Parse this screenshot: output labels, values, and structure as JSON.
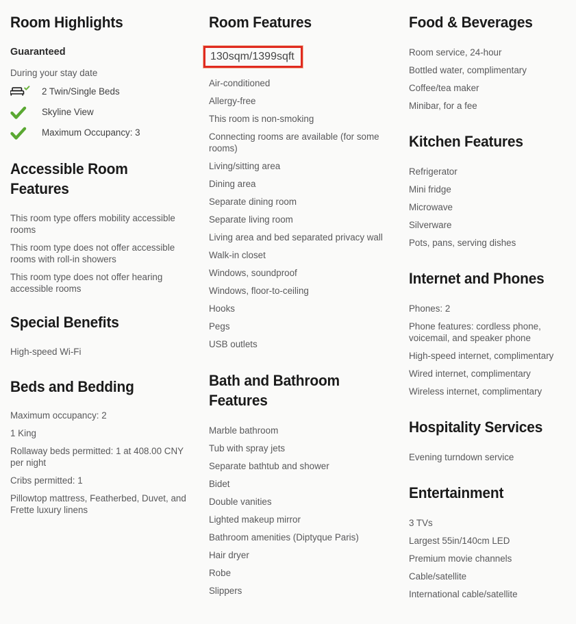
{
  "page": {
    "background": "#fafaf9",
    "text_color": "#58585a",
    "heading_color": "#1a1a1a",
    "accent_green": "#5aa832",
    "highlight_red": "#e02b20"
  },
  "columns": {
    "left": {
      "room_highlights": {
        "title": "Room Highlights",
        "subhead": "Guaranteed",
        "subnote": "During your stay date",
        "rows": [
          {
            "icon": "bed-check-icon",
            "label": "2 Twin/Single Beds"
          },
          {
            "icon": "check-icon",
            "label": "Skyline View"
          },
          {
            "icon": "check-icon",
            "label": "Maximum Occupancy: 3"
          }
        ]
      },
      "accessible_room_features": {
        "title": "Accessible Room Features",
        "items": [
          "This room type offers mobility accessible rooms",
          "This room type does not offer accessible rooms with roll-in showers",
          "This room type does not offer hearing accessible rooms"
        ]
      },
      "special_benefits": {
        "title": "Special Benefits",
        "items": [
          "High-speed Wi-Fi"
        ]
      },
      "beds_and_bedding": {
        "title": "Beds and Bedding",
        "items": [
          "Maximum occupancy: 2",
          "1 King",
          "Rollaway beds permitted: 1 at 408.00 CNY per night",
          "Cribs permitted: 1",
          "Pillowtop mattress, Featherbed, Duvet, and Frette luxury linens"
        ]
      }
    },
    "middle": {
      "room_features": {
        "title": "Room Features",
        "highlighted_item": "130sqm/1399sqft",
        "items": [
          "Air-conditioned",
          "Allergy-free",
          "This room is non-smoking",
          "Connecting rooms are available (for some rooms)",
          "Living/sitting area",
          "Dining area",
          "Separate dining room",
          "Separate living room",
          "Living area and bed separated privacy wall",
          "Walk-in closet",
          "Windows, soundproof",
          "Windows, floor-to-ceiling",
          "Hooks",
          "Pegs",
          "USB outlets"
        ]
      },
      "bath_and_bathroom_features": {
        "title": "Bath and Bathroom Features",
        "items": [
          "Marble bathroom",
          "Tub with spray jets",
          "Separate bathtub and shower",
          "Bidet",
          "Double vanities",
          "Lighted makeup mirror",
          "Bathroom amenities (Diptyque Paris)",
          "Hair dryer",
          "Robe",
          "Slippers"
        ]
      }
    },
    "right": {
      "food_and_beverages": {
        "title": "Food & Beverages",
        "items": [
          "Room service, 24-hour",
          "Bottled water, complimentary",
          "Coffee/tea maker",
          "Minibar, for a fee"
        ]
      },
      "kitchen_features": {
        "title": "Kitchen Features",
        "items": [
          "Refrigerator",
          "Mini fridge",
          "Microwave",
          "Silverware",
          "Pots, pans, serving dishes"
        ]
      },
      "internet_and_phones": {
        "title": "Internet and Phones",
        "items": [
          "Phones: 2",
          "Phone features: cordless phone, voicemail, and speaker phone",
          "High-speed internet, complimentary",
          "Wired internet, complimentary",
          "Wireless internet, complimentary"
        ]
      },
      "hospitality_services": {
        "title": "Hospitality Services",
        "items": [
          "Evening turndown service"
        ]
      },
      "entertainment": {
        "title": "Entertainment",
        "items": [
          "3 TVs",
          "Largest 55in/140cm LED",
          "Premium movie channels",
          "Cable/satellite",
          "International cable/satellite"
        ]
      }
    }
  }
}
